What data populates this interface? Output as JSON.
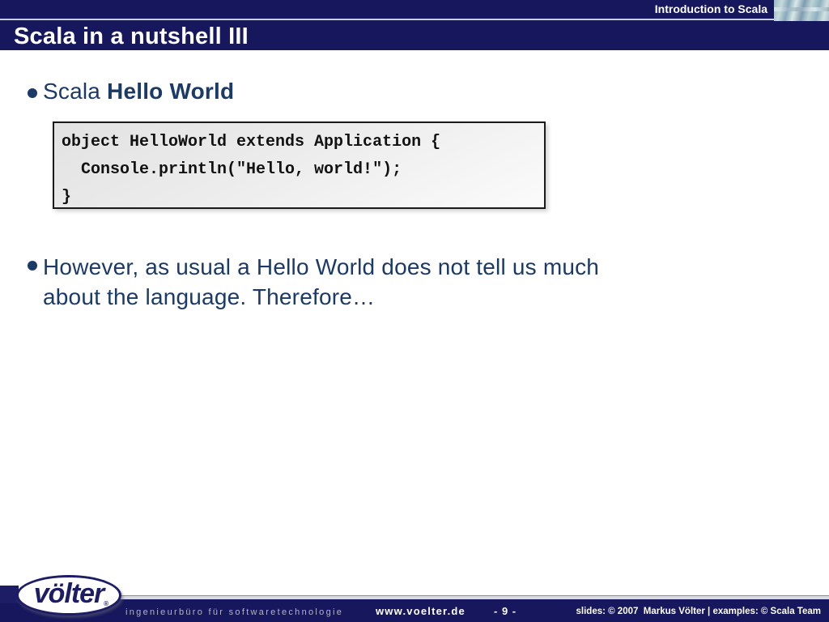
{
  "slide": {
    "header": {
      "context_label": "Introduction to Scala",
      "title": "Scala in a nutshell III"
    },
    "content": {
      "bullet1": {
        "lead": "Scala ",
        "emphasis": "Hello World"
      },
      "code": {
        "lines": [
          "object HelloWorld extends Application {",
          "  Console.println(\"Hello, world!\");",
          "}"
        ]
      },
      "bullet2": {
        "lines": [
          "However, as usual a Hello World does not tell us much",
          "about the language. Therefore…"
        ]
      }
    },
    "footer": {
      "logo_text": "völter",
      "logo_mark": "®",
      "tagline": "ingenieurbüro für softwaretechnologie",
      "website": "www.voelter.de",
      "page_number": "- 9 -",
      "credits": "slides: © 2007  Markus Völter | examples: © Scala Team"
    },
    "colors": {
      "navy_bar": "#17175E",
      "body_text_navy": "#1B3A68",
      "header_rule": "#C9CDE2",
      "code_border": "#1A1A1A",
      "code_background": "#E8E8E8",
      "footer_tagline_gray": "#B4B4C0",
      "logo_navy": "#1D1D66"
    }
  }
}
